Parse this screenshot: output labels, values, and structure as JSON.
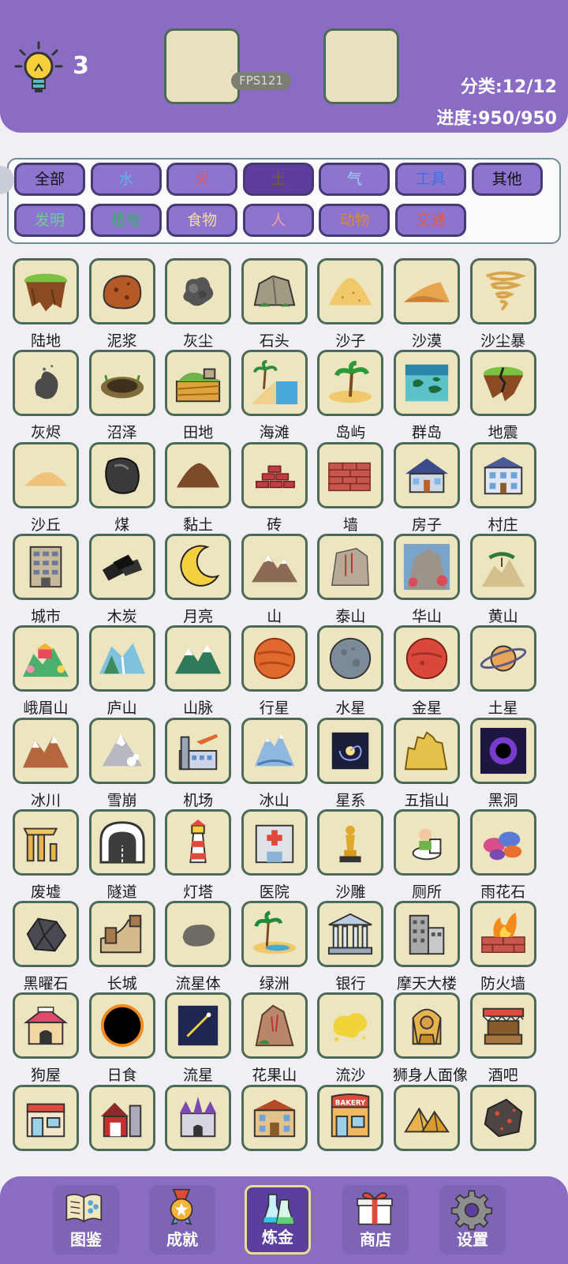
{
  "header": {
    "hint_count": "3",
    "fps": "FPS121",
    "category_stat": "分类:12/12",
    "progress_stat": "进度:950/950"
  },
  "categories": [
    {
      "label": "全部",
      "color": "#111111"
    },
    {
      "label": "水",
      "color": "#5cb7e6"
    },
    {
      "label": "火",
      "color": "#e8574a"
    },
    {
      "label": "土",
      "color": "#7a5c2a",
      "active": true
    },
    {
      "label": "气",
      "color": "#8fd7ef"
    },
    {
      "label": "工具",
      "color": "#3d72e0"
    },
    {
      "label": "其他",
      "color": "#111111"
    },
    {
      "label": "发明",
      "color": "#6ccf8c"
    },
    {
      "label": "植物",
      "color": "#3fae6a"
    },
    {
      "label": "食物",
      "color": "#f4dd9d"
    },
    {
      "label": "人",
      "color": "#f0a29a"
    },
    {
      "label": "动物",
      "color": "#d98a3c"
    },
    {
      "label": "交通",
      "color": "#e05a45"
    }
  ],
  "elements": [
    {
      "label": "陆地",
      "icon": "land-icon"
    },
    {
      "label": "泥浆",
      "icon": "mud-icon"
    },
    {
      "label": "灰尘",
      "icon": "dust-icon"
    },
    {
      "label": "石头",
      "icon": "stone-icon"
    },
    {
      "label": "沙子",
      "icon": "sand-icon"
    },
    {
      "label": "沙漠",
      "icon": "desert-icon"
    },
    {
      "label": "沙尘暴",
      "icon": "sandstorm-icon"
    },
    {
      "label": "灰烬",
      "icon": "ash-icon"
    },
    {
      "label": "沼泽",
      "icon": "swamp-icon"
    },
    {
      "label": "田地",
      "icon": "field-icon"
    },
    {
      "label": "海滩",
      "icon": "beach-icon"
    },
    {
      "label": "岛屿",
      "icon": "island-icon"
    },
    {
      "label": "群岛",
      "icon": "archipelago-icon"
    },
    {
      "label": "地震",
      "icon": "earthquake-icon"
    },
    {
      "label": "沙丘",
      "icon": "dune-icon"
    },
    {
      "label": "煤",
      "icon": "coal-icon"
    },
    {
      "label": "黏土",
      "icon": "clay-icon"
    },
    {
      "label": "砖",
      "icon": "brick-icon"
    },
    {
      "label": "墙",
      "icon": "wall-icon"
    },
    {
      "label": "房子",
      "icon": "house-icon"
    },
    {
      "label": "村庄",
      "icon": "village-icon"
    },
    {
      "label": "城市",
      "icon": "city-icon"
    },
    {
      "label": "木炭",
      "icon": "charcoal-icon"
    },
    {
      "label": "月亮",
      "icon": "moon-icon"
    },
    {
      "label": "山",
      "icon": "mountain-icon"
    },
    {
      "label": "泰山",
      "icon": "mount-tai-icon"
    },
    {
      "label": "华山",
      "icon": "mount-hua-icon"
    },
    {
      "label": "黄山",
      "icon": "mount-huang-icon"
    },
    {
      "label": "峨眉山",
      "icon": "mount-emei-icon"
    },
    {
      "label": "庐山",
      "icon": "mount-lu-icon"
    },
    {
      "label": "山脉",
      "icon": "mountain-range-icon"
    },
    {
      "label": "行星",
      "icon": "planet-icon"
    },
    {
      "label": "水星",
      "icon": "mercury-icon"
    },
    {
      "label": "金星",
      "icon": "venus-icon"
    },
    {
      "label": "土星",
      "icon": "saturn-icon"
    },
    {
      "label": "冰川",
      "icon": "glacier-icon"
    },
    {
      "label": "雪崩",
      "icon": "avalanche-icon"
    },
    {
      "label": "机场",
      "icon": "airport-icon"
    },
    {
      "label": "冰山",
      "icon": "iceberg-icon"
    },
    {
      "label": "星系",
      "icon": "galaxy-icon"
    },
    {
      "label": "五指山",
      "icon": "five-finger-mountain-icon"
    },
    {
      "label": "黑洞",
      "icon": "black-hole-icon"
    },
    {
      "label": "废墟",
      "icon": "ruins-icon"
    },
    {
      "label": "隧道",
      "icon": "tunnel-icon"
    },
    {
      "label": "灯塔",
      "icon": "lighthouse-icon"
    },
    {
      "label": "医院",
      "icon": "hospital-icon"
    },
    {
      "label": "沙雕",
      "icon": "sand-sculpture-icon"
    },
    {
      "label": "厕所",
      "icon": "toilet-icon"
    },
    {
      "label": "雨花石",
      "icon": "rain-flower-stone-icon"
    },
    {
      "label": "黑曜石",
      "icon": "obsidian-icon"
    },
    {
      "label": "长城",
      "icon": "great-wall-icon"
    },
    {
      "label": "流星体",
      "icon": "meteoroid-icon"
    },
    {
      "label": "绿洲",
      "icon": "oasis-icon"
    },
    {
      "label": "银行",
      "icon": "bank-icon"
    },
    {
      "label": "摩天大楼",
      "icon": "skyscraper-icon"
    },
    {
      "label": "防火墙",
      "icon": "firewall-icon"
    },
    {
      "label": "狗屋",
      "icon": "doghouse-icon"
    },
    {
      "label": "日食",
      "icon": "eclipse-icon"
    },
    {
      "label": "流星",
      "icon": "meteor-icon"
    },
    {
      "label": "花果山",
      "icon": "huaguo-mountain-icon"
    },
    {
      "label": "流沙",
      "icon": "quicksand-icon"
    },
    {
      "label": "狮身人面像",
      "icon": "sphinx-icon"
    },
    {
      "label": "酒吧",
      "icon": "bar-icon"
    },
    {
      "label": "",
      "icon": "post-office-icon"
    },
    {
      "label": "",
      "icon": "barn-icon"
    },
    {
      "label": "",
      "icon": "castle-icon"
    },
    {
      "label": "",
      "icon": "school-icon"
    },
    {
      "label": "",
      "icon": "bakery-icon"
    },
    {
      "label": "",
      "icon": "pyramid-icon"
    },
    {
      "label": "",
      "icon": "meteorite-icon"
    }
  ],
  "bakery_sign": "BAKERY",
  "nav": [
    {
      "label": "图鉴",
      "icon": "book-icon"
    },
    {
      "label": "成就",
      "icon": "medal-icon"
    },
    {
      "label": "炼金",
      "icon": "flask-icon",
      "active": true
    },
    {
      "label": "商店",
      "icon": "gift-icon"
    },
    {
      "label": "设置",
      "icon": "gear-icon"
    }
  ]
}
